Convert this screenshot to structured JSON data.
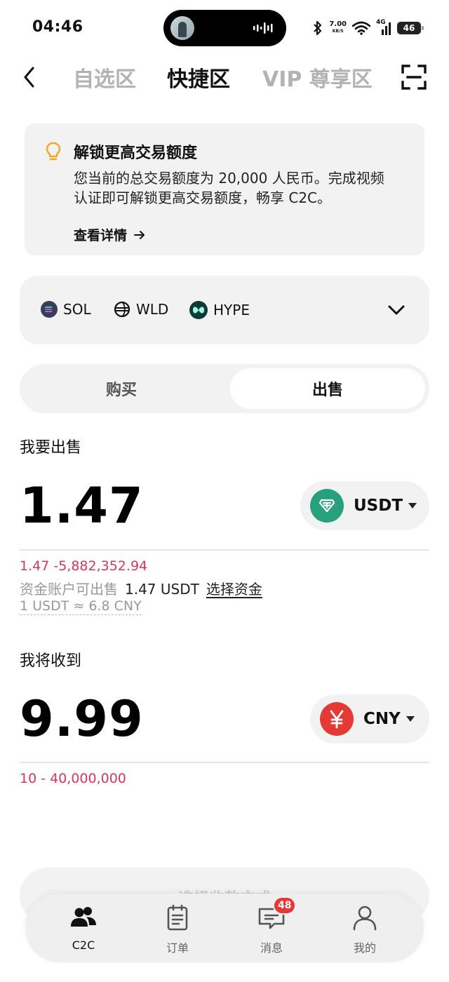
{
  "status_bar": {
    "time": "04:46",
    "network_speed": "7.00",
    "network_speed_unit": "KB/S",
    "signal_label": "4G",
    "battery": "46"
  },
  "top_nav": {
    "tabs": [
      {
        "label": "自选区",
        "active": false
      },
      {
        "label": "快捷区",
        "active": true
      },
      {
        "label": "VIP 尊享区",
        "active": false
      }
    ],
    "icons": {
      "back": "back-arrow-icon",
      "scan": "scan-icon"
    }
  },
  "notice": {
    "icon": "lightbulb-icon",
    "title": "解锁更高交易额度",
    "body": "您当前的总交易额度为 20,000 人民币。完成视频认证即可解锁更高交易额度，畅享 C2C。",
    "link_label": "查看详情"
  },
  "coins": [
    {
      "symbol": "SOL",
      "icon": "sol-coin-icon",
      "color": "#3d3d57"
    },
    {
      "symbol": "WLD",
      "icon": "wld-coin-icon",
      "color": "#111111"
    },
    {
      "symbol": "HYPE",
      "icon": "hype-coin-icon",
      "color": "#0e3b35"
    }
  ],
  "trade_mode": {
    "buy_label": "购买",
    "sell_label": "出售",
    "selected": "sell"
  },
  "sell": {
    "label": "我要出售",
    "amount": "1.47",
    "currency": "USDT",
    "currency_icon": "tether-icon",
    "currency_color": "#26a17b",
    "range": "1.47 -5,882,352.94",
    "available_label": "资金账户可出售",
    "available_value": "1.47 USDT",
    "select_funds_label": "选择资金",
    "rate": "1 USDT ≈ 6.8 CNY"
  },
  "receive": {
    "label": "我将收到",
    "amount": "9.99",
    "currency": "CNY",
    "currency_icon": "yuan-icon",
    "currency_color": "#e53935",
    "range": "10 - 40,000,000"
  },
  "cta": {
    "label": "选择收款方式"
  },
  "bottom_nav": {
    "items": [
      {
        "label": "C2C",
        "icon": "users-icon",
        "active": true
      },
      {
        "label": "订单",
        "icon": "orders-icon",
        "active": false
      },
      {
        "label": "消息",
        "icon": "messages-icon",
        "active": false,
        "badge": "48"
      },
      {
        "label": "我的",
        "icon": "profile-icon",
        "active": false
      }
    ]
  },
  "colors": {
    "accent_red": "#d7375a",
    "card_bg": "#f2f2f2",
    "badge_red": "#e53935"
  }
}
